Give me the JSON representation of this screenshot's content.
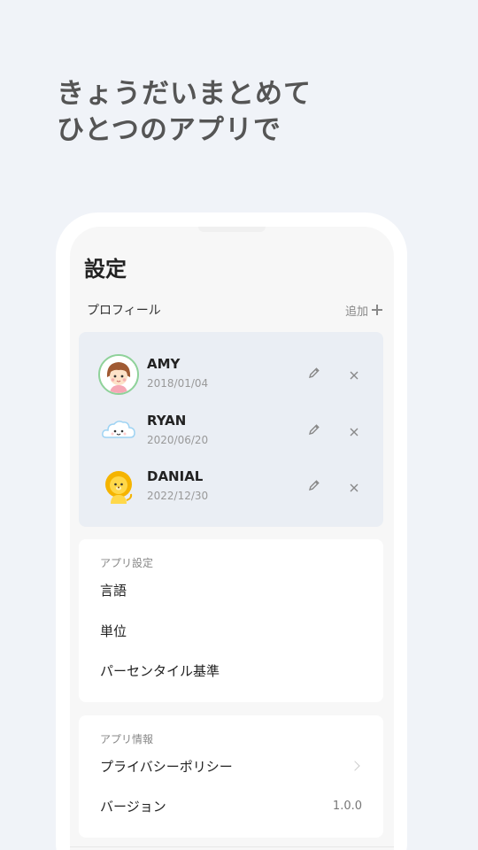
{
  "headline": {
    "line1": "きょうだいまとめて",
    "line2": "ひとつのアプリで"
  },
  "screen": {
    "title": "設定",
    "profile_section": {
      "label": "プロフィール",
      "add_label": "追加"
    },
    "profiles": [
      {
        "name": "AMY",
        "date": "2018/01/04",
        "avatar": "girl-avatar-icon"
      },
      {
        "name": "RYAN",
        "date": "2020/06/20",
        "avatar": "cloud-avatar-icon"
      },
      {
        "name": "DANIAL",
        "date": "2022/12/30",
        "avatar": "lion-avatar-icon"
      }
    ],
    "app_settings": {
      "heading": "アプリ設定",
      "items": [
        "言語",
        "単位",
        "パーセンタイル基準"
      ]
    },
    "app_info": {
      "heading": "アプリ情報",
      "privacy": "プライバシーポリシー",
      "version_label": "バージョン",
      "version_value": "1.0.0"
    }
  },
  "colors": {
    "background": "#f0f3f8",
    "profile_card": "#eaeef4",
    "avatar_ring": "#8fd29a",
    "headline": "#555555"
  }
}
